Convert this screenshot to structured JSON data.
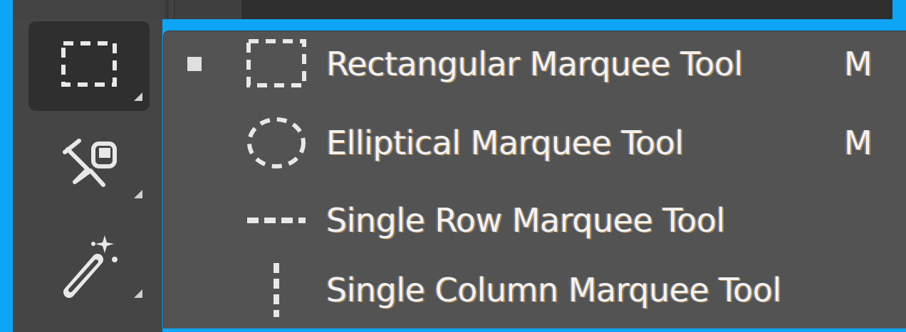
{
  "menu": {
    "items": [
      {
        "label": "Rectangular Marquee Tool",
        "shortcut": "M",
        "checked": true,
        "icon": "rectangular-marquee-icon"
      },
      {
        "label": "Elliptical Marquee Tool",
        "shortcut": "M",
        "checked": false,
        "icon": "elliptical-marquee-icon"
      },
      {
        "label": "Single Row Marquee Tool",
        "shortcut": "",
        "checked": false,
        "icon": "single-row-marquee-icon"
      },
      {
        "label": "Single Column Marquee Tool",
        "shortcut": "",
        "checked": false,
        "icon": "single-column-marquee-icon"
      }
    ]
  },
  "toolbar": {
    "tools": [
      {
        "icon": "rectangular-marquee-icon",
        "active": true
      },
      {
        "icon": "object-selection-icon",
        "active": false
      },
      {
        "icon": "magic-wand-icon",
        "active": false
      }
    ]
  },
  "colors": {
    "frame": "#0ea5f5",
    "panel": "#535353",
    "toolbar": "#454545",
    "active_tool": "#2f2f2f",
    "text": "#f2f2f2"
  }
}
